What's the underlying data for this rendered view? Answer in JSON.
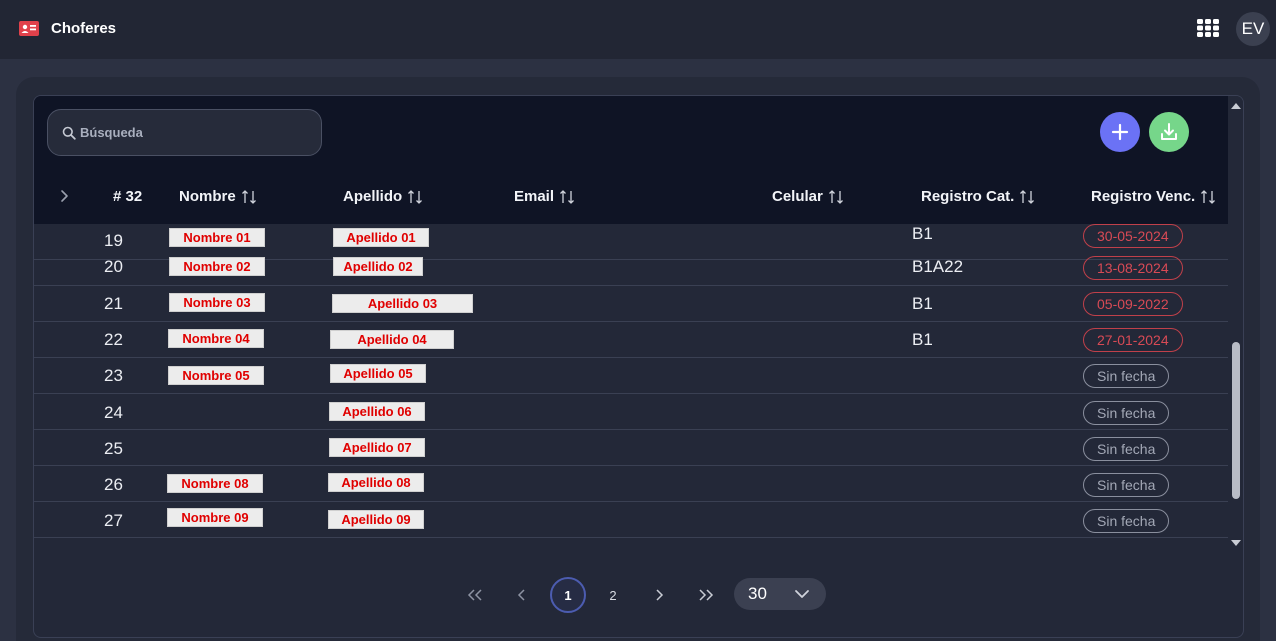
{
  "app": {
    "title": "Choferes",
    "user_initials": "EV"
  },
  "icons": {
    "app": "id-card-icon",
    "apps": "grid-icon",
    "search": "search-icon",
    "add": "plus-icon",
    "download": "download-icon",
    "sort": "sort-icon",
    "expand": "chevron-right-icon"
  },
  "colors": {
    "accent": "#6b72f5",
    "download": "#76d68a",
    "expired": "#d84a55",
    "app_icon": "#e0414b"
  },
  "search": {
    "placeholder": "Búsqueda",
    "value": ""
  },
  "table": {
    "headers": {
      "count": "# 32",
      "nombre": "Nombre",
      "apellido": "Apellido",
      "email": "Email",
      "celular": "Celular",
      "registro_cat": "Registro Cat.",
      "registro_venc": "Registro Venc."
    },
    "rows": [
      {
        "num": "19",
        "nombre": "Nombre 01",
        "apellido": "Apellido 01",
        "registro_cat": "B1",
        "registro_venc": "30-05-2024",
        "expired": true
      },
      {
        "num": "20",
        "nombre": "Nombre 02",
        "apellido": "Apellido 02",
        "registro_cat": "B1A22",
        "registro_venc": "13-08-2024",
        "expired": true
      },
      {
        "num": "21",
        "nombre": "Nombre 03",
        "apellido": "Apellido 03",
        "registro_cat": "B1",
        "registro_venc": "05-09-2022",
        "expired": true
      },
      {
        "num": "22",
        "nombre": "Nombre 04",
        "apellido": "Apellido 04",
        "registro_cat": "B1",
        "registro_venc": "27-01-2024",
        "expired": true
      },
      {
        "num": "23",
        "nombre": "Nombre 05",
        "apellido": "Apellido 05",
        "registro_cat": "",
        "registro_venc": "Sin fecha",
        "expired": false
      },
      {
        "num": "24",
        "nombre": "",
        "apellido": "Apellido 06",
        "registro_cat": "",
        "registro_venc": "Sin fecha",
        "expired": false
      },
      {
        "num": "25",
        "nombre": "",
        "apellido": "Apellido 07",
        "registro_cat": "",
        "registro_venc": "Sin fecha",
        "expired": false
      },
      {
        "num": "26",
        "nombre": "Nombre 08",
        "apellido": "Apellido 08",
        "registro_cat": "",
        "registro_venc": "Sin fecha",
        "expired": false
      },
      {
        "num": "27",
        "nombre": "Nombre 09",
        "apellido": "Apellido 09",
        "registro_cat": "",
        "registro_venc": "Sin fecha",
        "expired": false
      }
    ]
  },
  "pagination": {
    "pages": [
      "1",
      "2"
    ],
    "current": "1",
    "per_page": "30"
  }
}
